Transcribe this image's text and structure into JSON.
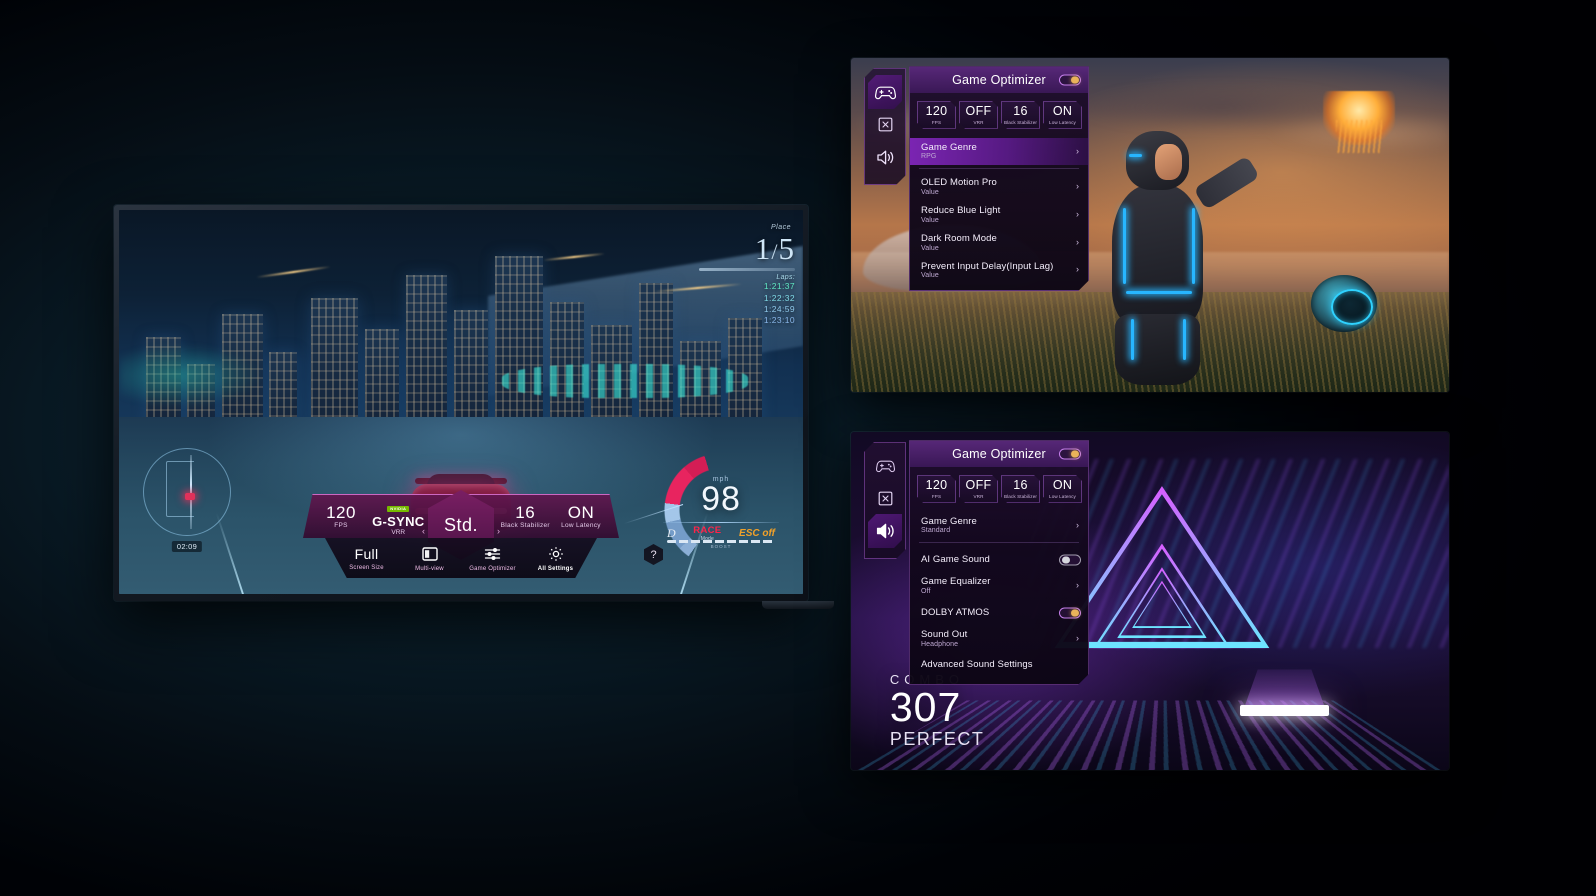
{
  "main_tv": {
    "hud": {
      "place_label": "Place",
      "place_value": "1",
      "place_total": "5",
      "laps_label": "Laps:",
      "lap_times": [
        "1:21:37",
        "1:22:32",
        "1:24:59",
        "1:23:10"
      ],
      "minimap_time": "02:09",
      "speedometer": {
        "unit": "mph",
        "value": "98",
        "gear": "D",
        "mode_value": "RACE",
        "mode_label": "Mode",
        "esc": "ESC off",
        "boost_label": "BOOST"
      }
    },
    "game_bar": {
      "fps_value": "120",
      "fps_label": "FPS",
      "vrr_brand_tag": "NVIDIA",
      "vrr_value": "G-SYNC",
      "vrr_label": "VRR",
      "picture_mode": "Std.",
      "black_stabilizer_value": "16",
      "black_stabilizer_label": "Black Stabilizer",
      "low_latency_value": "ON",
      "low_latency_label": "Low Latency",
      "dots": "...",
      "items": [
        {
          "value": "Full",
          "label": "Screen Size",
          "icon": "text-icon",
          "selected": false
        },
        {
          "value": "",
          "label": "Multi-view",
          "icon": "multiview-icon",
          "selected": false
        },
        {
          "value": "",
          "label": "Game Optimizer",
          "icon": "sliders-icon",
          "selected": false
        },
        {
          "value": "",
          "label": "All Settings",
          "icon": "gear-icon",
          "selected": true
        }
      ],
      "help_glyph": "?",
      "arrow_left": "‹",
      "arrow_right": "›"
    }
  },
  "panel_top": {
    "rail": [
      {
        "name": "gamepad-icon",
        "selected": true
      },
      {
        "name": "picture-icon",
        "selected": false
      },
      {
        "name": "speaker-icon",
        "selected": false
      }
    ],
    "optimizer": {
      "title": "Game Optimizer",
      "toggle_state": "on",
      "chips": [
        {
          "value": "120",
          "label": "FPS"
        },
        {
          "value": "OFF",
          "label": "VRR"
        },
        {
          "value": "16",
          "label": "Black Stabilizer"
        },
        {
          "value": "ON",
          "label": "Low Latency"
        }
      ],
      "items": [
        {
          "title": "Game Genre",
          "sub": "RPG",
          "control": "chevron",
          "highlighted": true
        },
        {
          "title": "OLED Motion Pro",
          "sub": "Value",
          "control": "chevron",
          "highlighted": false
        },
        {
          "title": "Reduce Blue Light",
          "sub": "Value",
          "control": "chevron",
          "highlighted": false
        },
        {
          "title": "Dark Room Mode",
          "sub": "Value",
          "control": "chevron",
          "highlighted": false
        },
        {
          "title": "Prevent Input Delay(Input Lag)",
          "sub": "Value",
          "control": "chevron",
          "highlighted": false
        }
      ]
    }
  },
  "panel_bottom": {
    "rail": [
      {
        "name": "gamepad-icon",
        "selected": false
      },
      {
        "name": "picture-icon",
        "selected": false
      },
      {
        "name": "speaker-icon",
        "selected": true
      }
    ],
    "optimizer": {
      "title": "Game Optimizer",
      "toggle_state": "on",
      "chips": [
        {
          "value": "120",
          "label": "FPS"
        },
        {
          "value": "OFF",
          "label": "VRR"
        },
        {
          "value": "16",
          "label": "Black Stabilizer"
        },
        {
          "value": "ON",
          "label": "Low Latency"
        }
      ],
      "items": [
        {
          "title": "Game Genre",
          "sub": "Standard",
          "control": "chevron",
          "highlighted": false
        },
        {
          "title": "AI Game Sound",
          "sub": "",
          "control": "toggle-off",
          "highlighted": false
        },
        {
          "title": "Game Equalizer",
          "sub": "Off",
          "control": "chevron",
          "highlighted": false
        },
        {
          "title": "DOLBY ATMOS",
          "sub": "",
          "control": "toggle-on",
          "highlighted": false
        },
        {
          "title": "Sound Out",
          "sub": "Headphone",
          "control": "chevron",
          "highlighted": false
        },
        {
          "title": "Advanced Sound Settings",
          "sub": "",
          "control": "none",
          "highlighted": false
        }
      ]
    },
    "game_overlay": {
      "combo_label": "COMBO",
      "combo_value": "307",
      "judgement": "PERFECT"
    }
  },
  "colors": {
    "accent_magenta": "#c23ad6",
    "accent_purple": "#8026ba",
    "toggle_on": "#e9b35a",
    "neon_cyan": "#27b6ff",
    "speed_red": "#e8245f"
  }
}
